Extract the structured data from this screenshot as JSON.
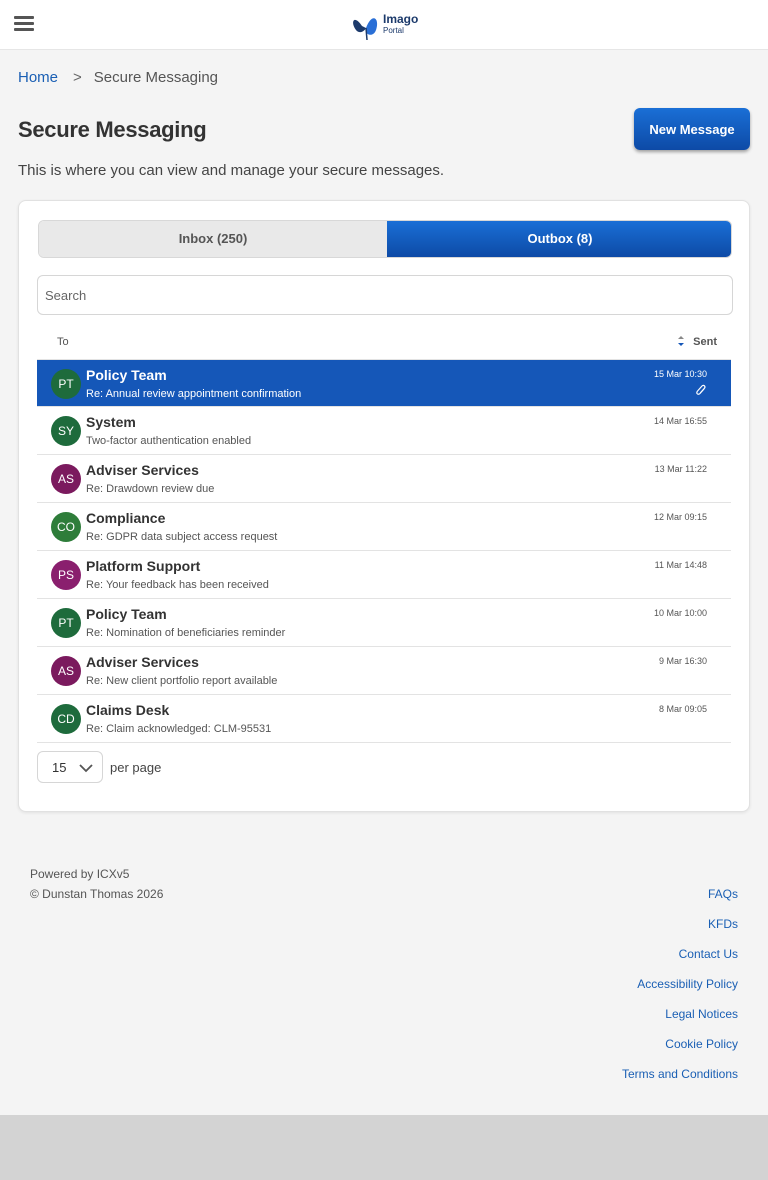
{
  "header": {
    "logo_title": "Imago",
    "logo_subtitle": "Portal",
    "menu_icon": "hamburger-icon",
    "brand_color": "#1c3a6b"
  },
  "breadcrumb": {
    "home": "Home",
    "separator": ">",
    "current": "Secure Messaging"
  },
  "page": {
    "title": "Secure Messaging",
    "description": "This is where you can view and manage your secure messages.",
    "new_message_label": "New Message",
    "accent_color": "#1557b8"
  },
  "tabs": [
    {
      "label": "Inbox (250)",
      "active": false
    },
    {
      "label": "Outbox (8)",
      "active": true
    }
  ],
  "search": {
    "placeholder": "Search",
    "value": ""
  },
  "columns": {
    "to": "To",
    "sent": "Sent",
    "sort_icon": "sort-desc-icon"
  },
  "messages": [
    {
      "initials": "PT",
      "name": "Policy Team",
      "subject": "Re: Annual review appointment confirmation",
      "date": "15 Mar 10:30",
      "color": "#1e6b3c",
      "attachment": true,
      "selected": true
    },
    {
      "initials": "SY",
      "name": "System",
      "subject": "Two-factor authentication enabled",
      "date": "14 Mar 16:55",
      "color": "#1e6b3c",
      "attachment": false,
      "selected": false
    },
    {
      "initials": "AS",
      "name": "Adviser Services",
      "subject": "Re: Drawdown review due",
      "date": "13 Mar 11:22",
      "color": "#7b1a5e",
      "attachment": false,
      "selected": false
    },
    {
      "initials": "CO",
      "name": "Compliance",
      "subject": "Re: GDPR data subject access request",
      "date": "12 Mar 09:15",
      "color": "#2e7d3a",
      "attachment": false,
      "selected": false
    },
    {
      "initials": "PS",
      "name": "Platform Support",
      "subject": "Re: Your feedback has been received",
      "date": "11 Mar 14:48",
      "color": "#8a1f6e",
      "attachment": false,
      "selected": false
    },
    {
      "initials": "PT",
      "name": "Policy Team",
      "subject": "Re: Nomination of beneficiaries reminder",
      "date": "10 Mar 10:00",
      "color": "#1e6b3c",
      "attachment": false,
      "selected": false
    },
    {
      "initials": "AS",
      "name": "Adviser Services",
      "subject": "Re: New client portfolio report available",
      "date": "9 Mar 16:30",
      "color": "#7b1a5e",
      "attachment": false,
      "selected": false
    },
    {
      "initials": "CD",
      "name": "Claims Desk",
      "subject": "Re: Claim acknowledged: CLM-95531",
      "date": "8 Mar 09:05",
      "color": "#1e6b3c",
      "attachment": false,
      "selected": false
    }
  ],
  "pager": {
    "per_page_value": "15",
    "per_page_label": "per page"
  },
  "footer": {
    "powered_by": "Powered by ICXv5",
    "copyright": "© Dunstan Thomas 2026",
    "links": [
      "FAQs",
      "KFDs",
      "Contact Us",
      "Accessibility Policy",
      "Legal Notices",
      "Cookie Policy",
      "Terms and Conditions"
    ]
  }
}
